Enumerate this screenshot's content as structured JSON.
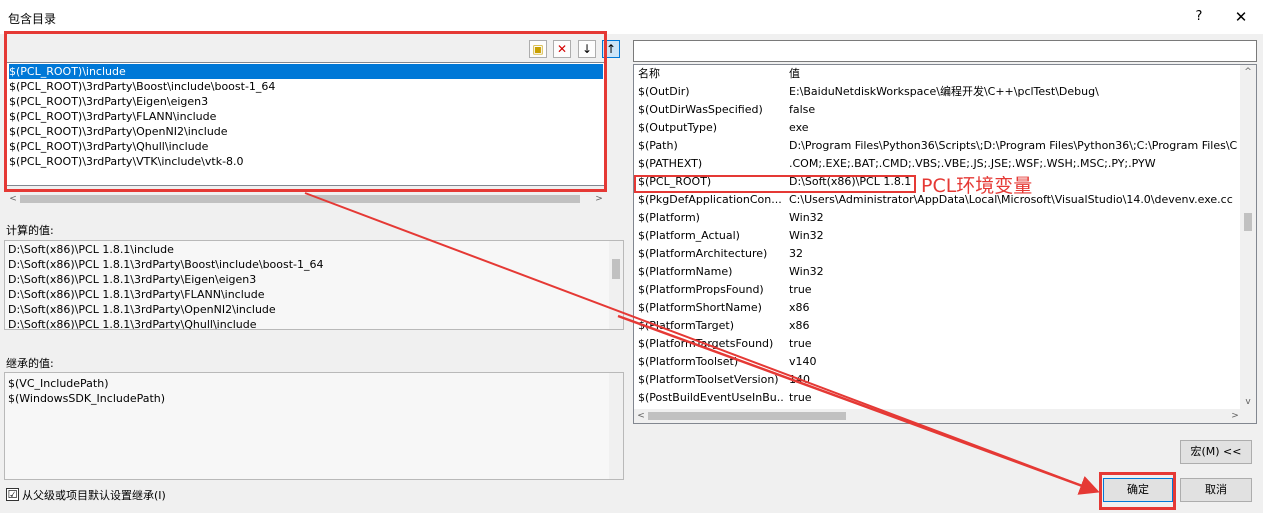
{
  "window": {
    "title": "包含目录",
    "help": "?",
    "close": "✕"
  },
  "include_dirs": [
    "$(PCL_ROOT)\\include",
    "$(PCL_ROOT)\\3rdParty\\Boost\\include\\boost-1_64",
    "$(PCL_ROOT)\\3rdParty\\Eigen\\eigen3",
    "$(PCL_ROOT)\\3rdParty\\FLANN\\include",
    "$(PCL_ROOT)\\3rdParty\\OpenNI2\\include",
    "$(PCL_ROOT)\\3rdParty\\Qhull\\include",
    "$(PCL_ROOT)\\3rdParty\\VTK\\include\\vtk-8.0"
  ],
  "computed": {
    "label": "计算的值:",
    "values": [
      "D:\\Soft(x86)\\PCL 1.8.1\\include",
      "D:\\Soft(x86)\\PCL 1.8.1\\3rdParty\\Boost\\include\\boost-1_64",
      "D:\\Soft(x86)\\PCL 1.8.1\\3rdParty\\Eigen\\eigen3",
      "D:\\Soft(x86)\\PCL 1.8.1\\3rdParty\\FLANN\\include",
      "D:\\Soft(x86)\\PCL 1.8.1\\3rdParty\\OpenNI2\\include",
      "D:\\Soft(x86)\\PCL 1.8.1\\3rdParty\\Qhull\\include"
    ]
  },
  "inherited": {
    "label": "继承的值:",
    "values": [
      "$(VC_IncludePath)",
      "$(WindowsSDK_IncludePath)"
    ]
  },
  "inherit_checkbox": {
    "label": "从父级或项目默认设置继承(I)",
    "mark": "☑"
  },
  "macros": {
    "header_name": "名称",
    "header_value": "值",
    "rows": [
      {
        "name": "$(OutDir)",
        "value": "E:\\BaiduNetdiskWorkspace\\编程开发\\C++\\pclTest\\Debug\\"
      },
      {
        "name": "$(OutDirWasSpecified)",
        "value": "false"
      },
      {
        "name": "$(OutputType)",
        "value": "exe"
      },
      {
        "name": "$(Path)",
        "value": "D:\\Program Files\\Python36\\Scripts\\;D:\\Program Files\\Python36\\;C:\\Program Files\\C"
      },
      {
        "name": "$(PATHEXT)",
        "value": ".COM;.EXE;.BAT;.CMD;.VBS;.VBE;.JS;.JSE;.WSF;.WSH;.MSC;.PY;.PYW"
      },
      {
        "name": "$(PCL_ROOT)",
        "value": "D:\\Soft(x86)\\PCL 1.8.1"
      },
      {
        "name": "$(PkgDefApplicationCon...",
        "value": "C:\\Users\\Administrator\\AppData\\Local\\Microsoft\\VisualStudio\\14.0\\devenv.exe.cc"
      },
      {
        "name": "$(Platform)",
        "value": "Win32"
      },
      {
        "name": "$(Platform_Actual)",
        "value": "Win32"
      },
      {
        "name": "$(PlatformArchitecture)",
        "value": "32"
      },
      {
        "name": "$(PlatformName)",
        "value": "Win32"
      },
      {
        "name": "$(PlatformPropsFound)",
        "value": "true"
      },
      {
        "name": "$(PlatformShortName)",
        "value": "x86"
      },
      {
        "name": "$(PlatformTarget)",
        "value": "x86"
      },
      {
        "name": "$(PlatformTargetsFound)",
        "value": "true"
      },
      {
        "name": "$(PlatformToolset)",
        "value": "v140"
      },
      {
        "name": "$(PlatformToolsetVersion)",
        "value": "140"
      },
      {
        "name": "$(PostBuildEventUseInBu...",
        "value": "true"
      }
    ]
  },
  "annotation": "PCL环境变量",
  "buttons": {
    "macro": "宏(M) <<",
    "ok": "确定",
    "cancel": "取消"
  },
  "toolbar": {
    "new_folder": "▣",
    "delete": "✕",
    "down": "↓",
    "up": "↑"
  },
  "colors": {
    "highlight_red": "#e53935",
    "selection_blue": "#0078d7"
  }
}
